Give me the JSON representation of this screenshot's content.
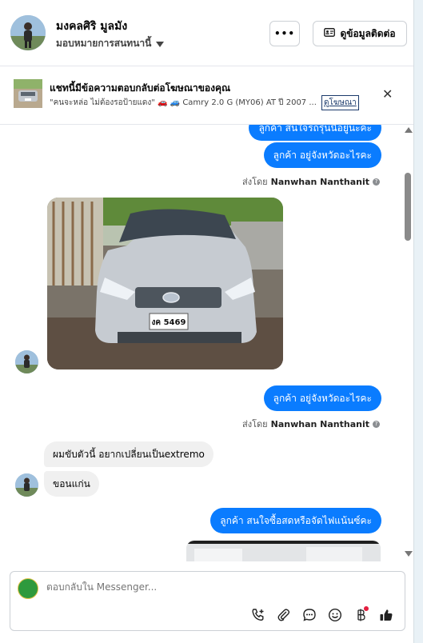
{
  "header": {
    "name": "มงคลศิริ มูลมัง",
    "assign_label": "มอบหมายการสนทนานี้",
    "more_label": "•••",
    "contact_label": "ดูข้อมูลติดต่อ"
  },
  "ad_banner": {
    "title": "แชทนี้มีข้อความตอบกลับต่อโฆษณาของคุณ",
    "subtitle": "\"คนจะหล่อ ไม่ต้องรอป้ายแดง\" 🚗 🚙 Camry 2.0 G (MY06) AT ปี 2007 ...",
    "link_label": "ดูโฆษณา",
    "close_label": "✕"
  },
  "messages": {
    "m0": "ลูกค้า สนใจรถรุ่นนี้อยู่นะคะ",
    "m1": "ลูกค้า อยู่จังหวัดอะไรคะ",
    "sent_by_1": {
      "prefix": "ส่งโดย",
      "name": "Nanwhan Nanthanit"
    },
    "plate": "งค 5469",
    "m2": "ลูกค้า อยู่จังหวัดอะไรคะ",
    "sent_by_2": {
      "prefix": "ส่งโดย",
      "name": "Nanwhan Nanthanit"
    },
    "m3": "ผมขับตัวนี้ อยากเปลี่ยนเป็นextremo",
    "m4": "ขอนแก่น",
    "m5": "ลูกค้า สนใจซื้อสดหรือจัดไฟแน้นซ์คะ"
  },
  "composer": {
    "placeholder": "ตอบกลับใน Messenger..."
  },
  "colors": {
    "accent": "#0a7cff",
    "incoming_bubble": "#f0f0f0",
    "notification_dot": "#e41e3f"
  },
  "icons": [
    "caret-down-icon",
    "contact-card-icon",
    "close-icon",
    "info-icon",
    "call-add-icon",
    "attachment-icon",
    "saved-reply-icon",
    "emoji-icon",
    "baht-payment-icon",
    "thumbs-up-icon"
  ]
}
